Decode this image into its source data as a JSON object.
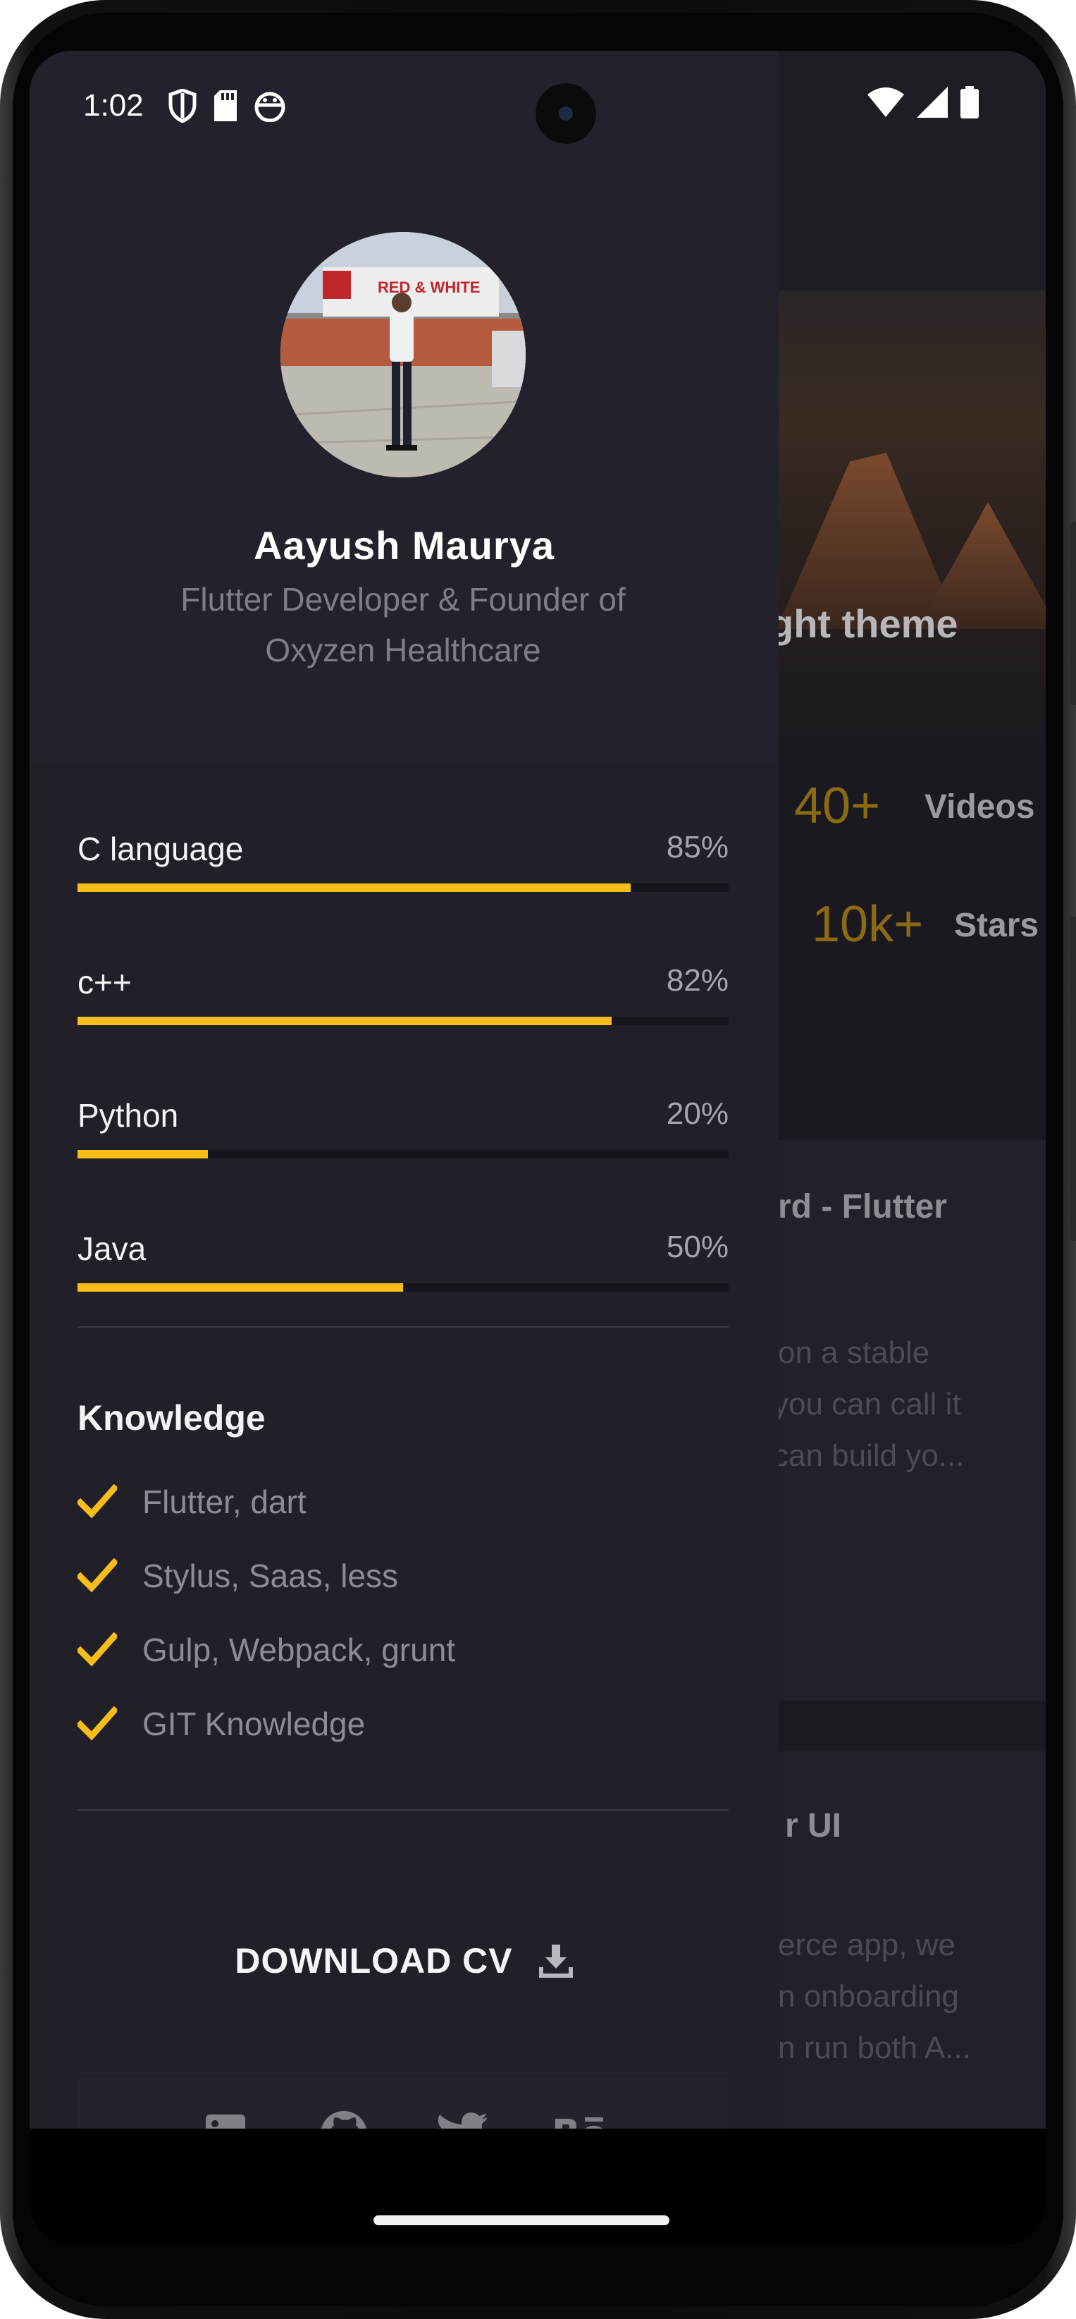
{
  "status_bar": {
    "time": "1:02"
  },
  "profile": {
    "name": "Aayush Maurya",
    "subtitle_line1": "Flutter Developer & Founder of",
    "subtitle_line2": "Oxyzen Healthcare",
    "avatar_sign_text": "RED & WHITE"
  },
  "skills": [
    {
      "name": "C language",
      "percent_label": "85%",
      "value": 85
    },
    {
      "name": "c++",
      "percent_label": "82%",
      "value": 82
    },
    {
      "name": "Python",
      "percent_label": "20%",
      "value": 20
    },
    {
      "name": "Java",
      "percent_label": "50%",
      "value": 50
    }
  ],
  "knowledge": {
    "title": "Knowledge",
    "items": [
      "Flutter, dart",
      "Stylus, Saas, less",
      "Gulp, Webpack, grunt",
      "GIT Knowledge"
    ]
  },
  "download": {
    "label": "DOWNLOAD CV"
  },
  "social": [
    "linkedin-icon",
    "github-icon",
    "twitter-icon",
    "behance-icon"
  ],
  "background_page": {
    "hero_text": "ght theme",
    "stats": [
      {
        "number": "40+",
        "label": "Videos"
      },
      {
        "number": "10k+",
        "label": "Stars"
      }
    ],
    "card1": {
      "title": "rd - Flutter",
      "lines": [
        "on a stable",
        "you can call it",
        "can build yo..."
      ]
    },
    "card2": {
      "title": "r UI",
      "lines": [
        "erce app, we",
        "n onboarding",
        "n run both A..."
      ]
    }
  },
  "colors": {
    "accent": "#f8bd18",
    "drawer_bg": "#212029",
    "header_bg": "#23222c"
  }
}
